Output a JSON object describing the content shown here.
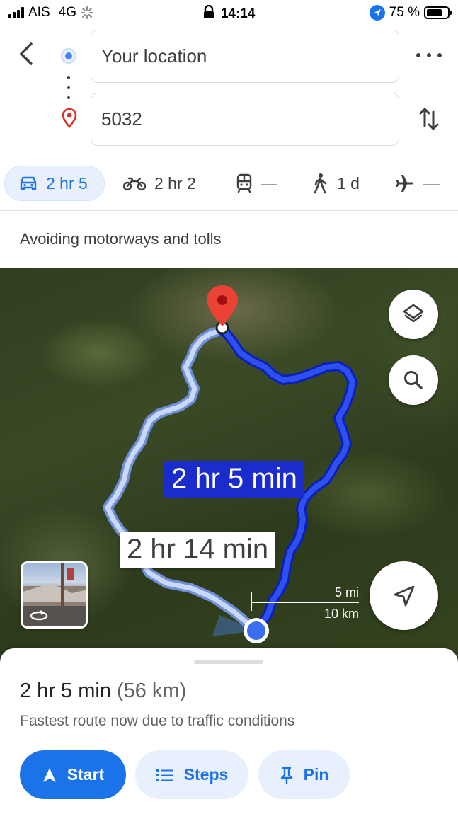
{
  "status_bar": {
    "carrier": "AIS",
    "network": "4G",
    "time": "14:14",
    "battery": "75 %",
    "battery_level": 0.75
  },
  "search": {
    "origin": "Your location",
    "destination": "5032"
  },
  "modes": [
    {
      "icon": "car-icon",
      "label": "2 hr 5",
      "active": true
    },
    {
      "icon": "motorbike-icon",
      "label": "2 hr 2"
    },
    {
      "icon": "transit-icon",
      "label": "—"
    },
    {
      "icon": "walking-icon",
      "label": "1 d"
    },
    {
      "icon": "flight-icon",
      "label": "—"
    }
  ],
  "route_note": "Avoiding motorways and tolls",
  "map": {
    "fastest_label": "2 hr 5 min",
    "alternate_label": "2 hr 14 min",
    "scale_mi": "5 mi",
    "scale_km": "10 km",
    "colors": {
      "fastest_route": "#1a2dcc",
      "alternate_route": "#a8c0f0",
      "pin": "#ea4335"
    }
  },
  "sheet": {
    "duration": "2 hr 5 min",
    "distance": "(56 km)",
    "reason": "Fastest route now due to traffic conditions",
    "start_label": "Start",
    "steps_label": "Steps",
    "pin_label": "Pin"
  }
}
